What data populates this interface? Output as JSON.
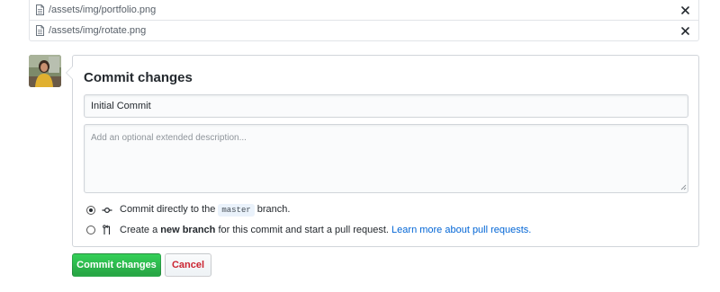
{
  "files": [
    {
      "path": "/assets/img/portfolio.png",
      "remove_icon": "close-icon"
    },
    {
      "path": "/assets/img/rotate.png",
      "remove_icon": "close-icon"
    }
  ],
  "commit": {
    "title": "Commit changes",
    "summary_value": "Initial Commit",
    "description_placeholder": "Add an optional extended description...",
    "description_value": ""
  },
  "options": {
    "direct": {
      "selected": true,
      "icon": "git-commit-icon",
      "text_before": "Commit directly to the",
      "branch": "master",
      "text_after": "branch."
    },
    "new_branch": {
      "selected": false,
      "icon": "git-pull-request-icon",
      "text_before": "Create a",
      "bold": "new branch",
      "text_after": "for this commit and start a pull request.",
      "link": "Learn more about pull requests."
    }
  },
  "buttons": {
    "commit": "Commit changes",
    "cancel": "Cancel"
  },
  "colors": {
    "commit_button": "#28a745",
    "cancel_text": "#cb2431",
    "link": "#0366d6"
  }
}
